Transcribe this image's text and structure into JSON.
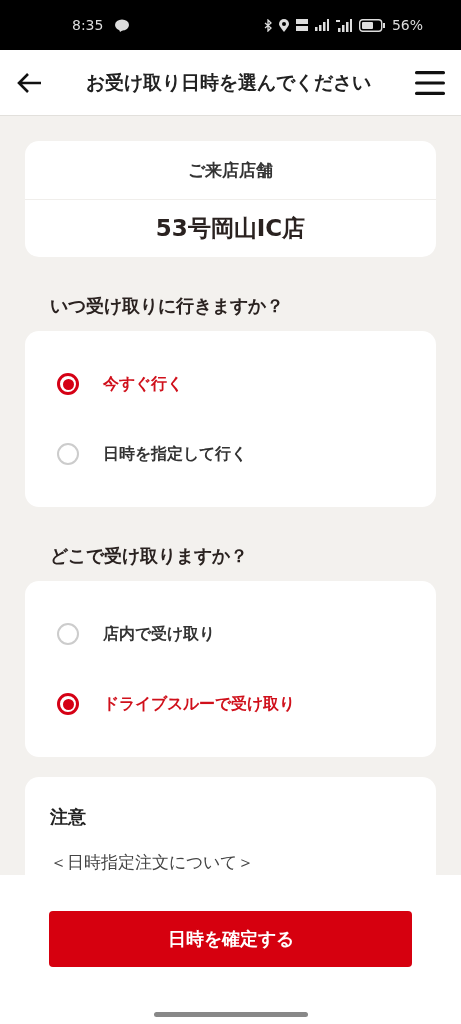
{
  "status_bar": {
    "time": "8:35",
    "battery": "56%"
  },
  "header": {
    "title": "お受け取り日時を選んでください"
  },
  "store": {
    "label": "ご来店店舗",
    "name": "53号岡山IC店"
  },
  "questions": [
    {
      "heading": "いつ受け取りに行きますか？",
      "options": [
        {
          "label": "今すぐ行く",
          "selected": true
        },
        {
          "label": "日時を指定して行く",
          "selected": false
        }
      ]
    },
    {
      "heading": "どこで受け取りますか？",
      "options": [
        {
          "label": "店内で受け取り",
          "selected": false
        },
        {
          "label": "ドライブスルーで受け取り",
          "selected": true
        }
      ]
    }
  ],
  "notice": {
    "title": "注意",
    "subtitle": "＜日時指定注文について＞"
  },
  "confirm_button": "日時を確定する"
}
